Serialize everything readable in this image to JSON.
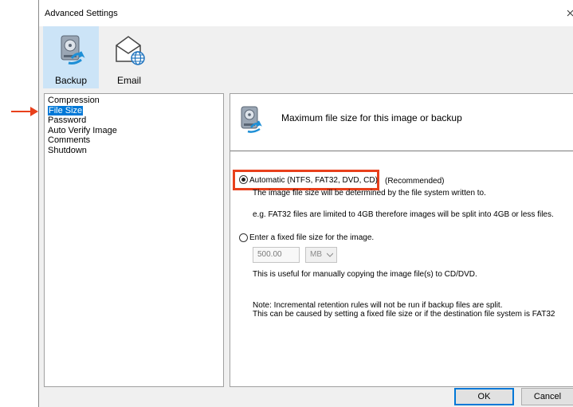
{
  "window": {
    "title": "Advanced Settings"
  },
  "toolbar": {
    "items": [
      {
        "label": "Backup",
        "icon": "backup-disk-icon",
        "selected": true
      },
      {
        "label": "Email",
        "icon": "email-globe-icon",
        "selected": false
      }
    ]
  },
  "sidebar": {
    "items": [
      {
        "label": "Compression"
      },
      {
        "label": "File Size",
        "selected": true
      },
      {
        "label": "Password"
      },
      {
        "label": "Auto Verify Image"
      },
      {
        "label": "Comments"
      },
      {
        "label": "Shutdown"
      }
    ]
  },
  "panel": {
    "header": "Maximum file size for this image or backup",
    "option_auto": {
      "label": "Automatic (NTFS, FAT32, DVD, CD)",
      "suffix": "(Recommended)",
      "checked": true
    },
    "auto_desc1": "The image file size will be determined by the file system written to.",
    "auto_desc2": "e.g. FAT32 files are limited to 4GB therefore images will be split into 4GB or less files.",
    "option_fixed": {
      "label": "Enter a fixed file size for the image.",
      "checked": false
    },
    "size_value": "500.00",
    "size_unit": "MB",
    "fixed_desc": "This is useful for manually copying the image file(s) to CD/DVD.",
    "note1": "Note: Incremental retention rules will not be run if backup files are split.",
    "note2": "This can be caused by setting a fixed file size or if the destination file system is FAT32"
  },
  "buttons": {
    "ok": "OK",
    "cancel": "Cancel"
  },
  "colors": {
    "highlight": "#e8401c",
    "selection": "#0078d7",
    "toolbar_selected": "#cce4f7"
  }
}
